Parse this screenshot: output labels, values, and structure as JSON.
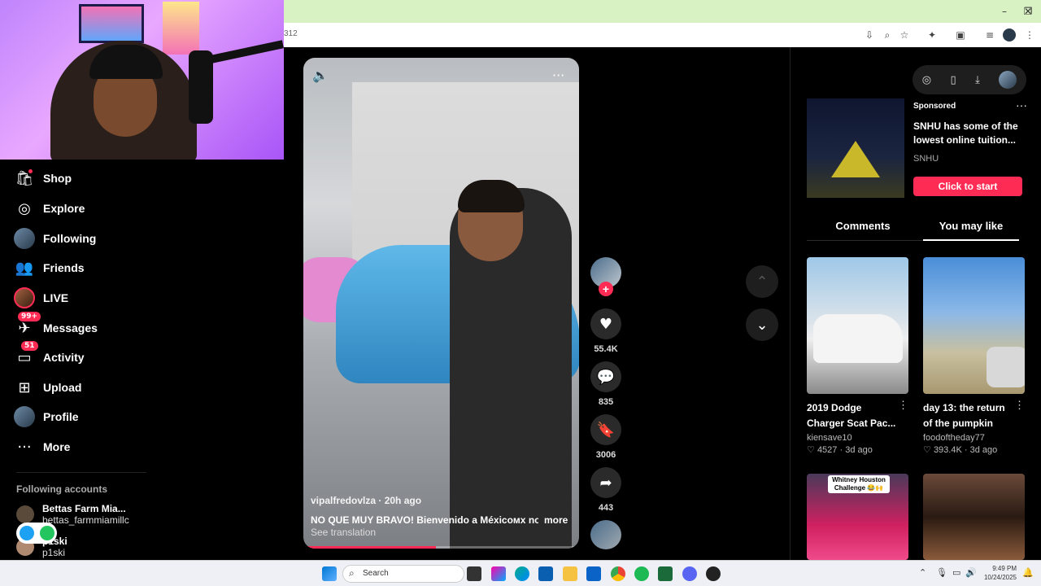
{
  "browser": {
    "url_fragment": "312",
    "window_controls": {
      "minimize": "–",
      "restore": "❐",
      "close": "✕"
    }
  },
  "nav": {
    "items": [
      {
        "label": "Shop",
        "icon": "shop-icon"
      },
      {
        "label": "Explore",
        "icon": "compass-icon"
      },
      {
        "label": "Following",
        "icon": "following-avatar"
      },
      {
        "label": "Friends",
        "icon": "friends-icon"
      },
      {
        "label": "LIVE",
        "icon": "live-avatar"
      },
      {
        "label": "Messages",
        "icon": "messages-icon",
        "badge": "99+"
      },
      {
        "label": "Activity",
        "icon": "activity-icon",
        "badge": "51"
      },
      {
        "label": "Upload",
        "icon": "upload-icon"
      },
      {
        "label": "Profile",
        "icon": "profile-avatar"
      },
      {
        "label": "More",
        "icon": "more-icon"
      }
    ],
    "following_accounts_title": "Following accounts",
    "accounts": [
      {
        "name": "Bettas Farm Mia...",
        "handle": "bettas_farmmiamillc"
      },
      {
        "name": "p1ski",
        "handle": "p1ski"
      }
    ]
  },
  "video": {
    "username": "vipalfredovlza",
    "time_ago": "20h ago",
    "caption": "NO QUE MUY BRAVO! Bienvenido a Méxicoᴍx no ...",
    "more_label": "more",
    "translation_label": "See translation",
    "progress": 0.48
  },
  "actions": {
    "likes": "55.4K",
    "comments": "835",
    "saves": "3006",
    "shares": "443"
  },
  "right_panel": {
    "ad": {
      "sponsored_label": "Sponsored",
      "title": "SNHU has some of the lowest online tuition...",
      "brand": "SNHU",
      "cta": "Click to start"
    },
    "tabs": [
      {
        "label": "Comments",
        "active": false
      },
      {
        "label": "You may like",
        "active": true
      }
    ],
    "recommendations": [
      {
        "title": "2019 Dodge Charger Scat Pac...",
        "user": "kiensave10",
        "likes": "4527",
        "age": "3d ago"
      },
      {
        "title": "day 13: the return of the pumpkin",
        "user": "foodoftheday77",
        "likes": "393.4K",
        "age": "3d ago"
      },
      {
        "title": "",
        "overlay_text": "Whitney Houston Challenge 😂🙌",
        "user": "",
        "likes": "",
        "age": ""
      },
      {
        "title": "",
        "user": "",
        "likes": "",
        "age": ""
      }
    ]
  },
  "taskbar": {
    "search_placeholder": "Search",
    "time": "9:49 PM",
    "date": "10/24/2025"
  },
  "colors": {
    "accent": "#fe2c55",
    "browser_titlebar": "#d9f2c4"
  }
}
